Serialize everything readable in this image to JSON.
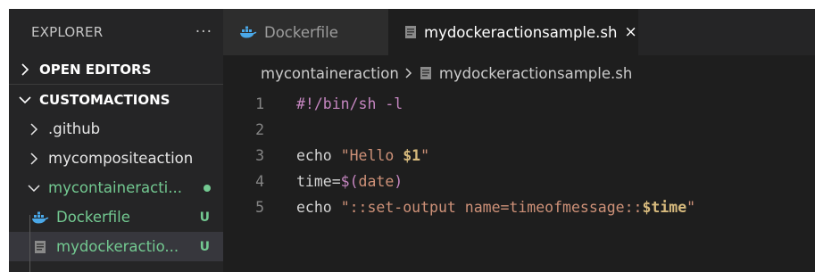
{
  "explorer": {
    "title": "EXPLORER",
    "more_label": "···",
    "sections": {
      "open_editors": "OPEN EDITORS",
      "workspace": "CUSTOMACTIONS"
    },
    "tree": {
      "github": ".github",
      "mycompositeaction": "mycompositeaction",
      "mycontaineraction": "mycontaineracti...",
      "dockerfile": {
        "label": "Dockerfile",
        "badge": "U"
      },
      "script": {
        "label": "mydockeractio...",
        "badge": "U"
      }
    }
  },
  "tabs": [
    {
      "label": "Dockerfile",
      "icon": "docker-icon"
    },
    {
      "label": "mydockeractionsample.sh",
      "icon": "file-icon",
      "close": "×"
    }
  ],
  "breadcrumb": {
    "folder": "mycontaineraction",
    "file": "mydockeractionsample.sh"
  },
  "code": {
    "lines": [
      {
        "num": "1",
        "shebang": "#!/bin/sh -l"
      },
      {
        "num": "2"
      },
      {
        "num": "3",
        "cmd": "echo",
        "str_open": "\"Hello ",
        "var": "$1",
        "str_close": "\""
      },
      {
        "num": "4",
        "assign": "time=",
        "sub_open": "$(",
        "subcmd": "date",
        "sub_close": ")"
      },
      {
        "num": "5",
        "cmd": "echo",
        "str_open": "\"::set-output name=timeofmessage::",
        "var": "$time",
        "str_close": "\""
      }
    ]
  },
  "colors": {
    "sidebar_bg": "#252526",
    "editor_bg": "#1e1e1e",
    "git_untracked": "#73c991",
    "string": "#ce9178",
    "keyword": "#c586c0",
    "variable": "#d7ba7d"
  }
}
